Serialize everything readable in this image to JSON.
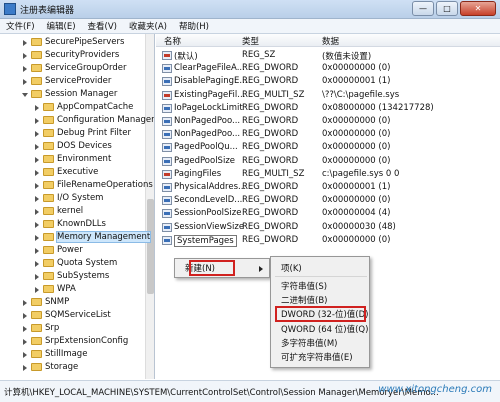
{
  "window": {
    "title": "注册表编辑器",
    "minimize": "—",
    "maximize": "□",
    "close": "✕"
  },
  "menu": [
    "文件(F)",
    "编辑(E)",
    "查看(V)",
    "收藏夹(A)",
    "帮助(H)"
  ],
  "tree": [
    {
      "label": "SecurePipeServers",
      "expanded": false,
      "selected": false
    },
    {
      "label": "SecurityProviders",
      "expanded": false,
      "selected": false
    },
    {
      "label": "ServiceGroupOrder",
      "expanded": false,
      "selected": false
    },
    {
      "label": "ServiceProvider",
      "expanded": false,
      "selected": false
    },
    {
      "label": "Session Manager",
      "expanded": true,
      "selected": false
    },
    {
      "label": "AppCompatCache",
      "expanded": false,
      "selected": false,
      "child": true
    },
    {
      "label": "Configuration Manager",
      "expanded": false,
      "selected": false,
      "child": true
    },
    {
      "label": "Debug Print Filter",
      "expanded": false,
      "selected": false,
      "child": true
    },
    {
      "label": "DOS Devices",
      "expanded": false,
      "selected": false,
      "child": true
    },
    {
      "label": "Environment",
      "expanded": false,
      "selected": false,
      "child": true
    },
    {
      "label": "Executive",
      "expanded": false,
      "selected": false,
      "child": true
    },
    {
      "label": "FileRenameOperations",
      "expanded": false,
      "selected": false,
      "child": true
    },
    {
      "label": "I/O System",
      "expanded": false,
      "selected": false,
      "child": true
    },
    {
      "label": "kernel",
      "expanded": false,
      "selected": false,
      "child": true
    },
    {
      "label": "KnownDLLs",
      "expanded": false,
      "selected": false,
      "child": true
    },
    {
      "label": "Memory Management",
      "expanded": false,
      "selected": true,
      "child": true
    },
    {
      "label": "Power",
      "expanded": false,
      "selected": false,
      "child": true
    },
    {
      "label": "Quota System",
      "expanded": false,
      "selected": false,
      "child": true
    },
    {
      "label": "SubSystems",
      "expanded": false,
      "selected": false,
      "child": true
    },
    {
      "label": "WPA",
      "expanded": false,
      "selected": false,
      "child": true
    },
    {
      "label": "SNMP",
      "expanded": false,
      "selected": false
    },
    {
      "label": "SQMServiceList",
      "expanded": false,
      "selected": false
    },
    {
      "label": "Srp",
      "expanded": false,
      "selected": false
    },
    {
      "label": "SrpExtensionConfig",
      "expanded": false,
      "selected": false
    },
    {
      "label": "StillImage",
      "expanded": false,
      "selected": false
    },
    {
      "label": "Storage",
      "expanded": false,
      "selected": false
    }
  ],
  "list": {
    "headers": {
      "name": "名称",
      "type": "类型",
      "data": "数据"
    },
    "rows": [
      {
        "name": "(默认)",
        "type": "REG_SZ",
        "data": "(数值未设置)",
        "kind": "str"
      },
      {
        "name": "ClearPageFileA...",
        "type": "REG_DWORD",
        "data": "0x00000000 (0)",
        "kind": "bin"
      },
      {
        "name": "DisablePagingE...",
        "type": "REG_DWORD",
        "data": "0x00000001 (1)",
        "kind": "bin"
      },
      {
        "name": "ExistingPageFil...",
        "type": "REG_MULTI_SZ",
        "data": "\\??\\C:\\pagefile.sys",
        "kind": "str"
      },
      {
        "name": "IoPageLockLimit",
        "type": "REG_DWORD",
        "data": "0x08000000 (134217728)",
        "kind": "bin"
      },
      {
        "name": "NonPagedPoo...",
        "type": "REG_DWORD",
        "data": "0x00000000 (0)",
        "kind": "bin"
      },
      {
        "name": "NonPagedPoo...",
        "type": "REG_DWORD",
        "data": "0x00000000 (0)",
        "kind": "bin"
      },
      {
        "name": "PagedPoolQu...",
        "type": "REG_DWORD",
        "data": "0x00000000 (0)",
        "kind": "bin"
      },
      {
        "name": "PagedPoolSize",
        "type": "REG_DWORD",
        "data": "0x00000000 (0)",
        "kind": "bin"
      },
      {
        "name": "PagingFiles",
        "type": "REG_MULTI_SZ",
        "data": "c:\\pagefile.sys 0 0",
        "kind": "str"
      },
      {
        "name": "PhysicalAddres...",
        "type": "REG_DWORD",
        "data": "0x00000001 (1)",
        "kind": "bin"
      },
      {
        "name": "SecondLevelD...",
        "type": "REG_DWORD",
        "data": "0x00000000 (0)",
        "kind": "bin"
      },
      {
        "name": "SessionPoolSize",
        "type": "REG_DWORD",
        "data": "0x00000004 (4)",
        "kind": "bin"
      },
      {
        "name": "SessionViewSize",
        "type": "REG_DWORD",
        "data": "0x00000030 (48)",
        "kind": "bin"
      },
      {
        "name": "SystemPages",
        "type": "REG_DWORD",
        "data": "0x00000000 (0)",
        "kind": "bin",
        "highlight": true
      }
    ]
  },
  "context_menu": {
    "new_label": "新建(N)"
  },
  "submenu": {
    "items": [
      "项(K)",
      "字符串值(S)",
      "二进制值(B)",
      "DWORD (32-位)值(D)",
      "QWORD (64 位)值(Q)",
      "多字符串值(M)",
      "可扩充字符串值(E)"
    ],
    "highlighted_index": 3
  },
  "status": {
    "path": "计算机\\HKEY_LOCAL_MACHINE\\SYSTEM\\CurrentControlSet\\Control\\Session Manager\\Memoryer\\Memo..."
  },
  "watermark": "www.xitongcheng.com"
}
